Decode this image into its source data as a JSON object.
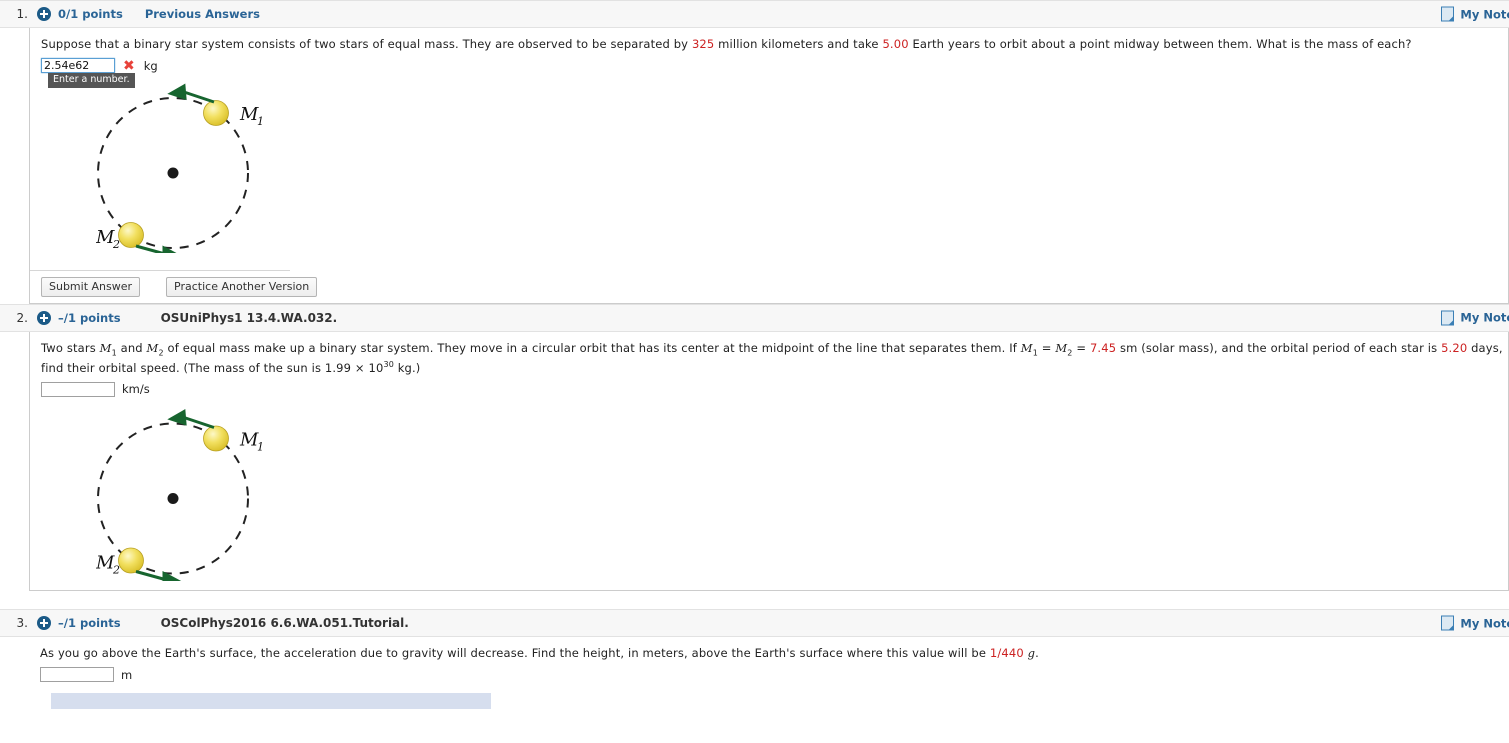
{
  "questions": [
    {
      "number": "1.",
      "points": "0/1 points",
      "previous_answers": "Previous Answers",
      "code": "",
      "notes_label": "My Notes",
      "notes_icon": "note-page-icon",
      "plus_icon": "plus-circle-icon",
      "prompt_parts": [
        {
          "t": "Suppose that a binary star system consists of two stars of equal mass. They are observed to be separated by ",
          "hl": false
        },
        {
          "t": "325",
          "hl": true
        },
        {
          "t": " million kilometers and take ",
          "hl": false
        },
        {
          "t": "5.00",
          "hl": true
        },
        {
          "t": " Earth years to orbit about a point midway between them. What is the mass of each?",
          "hl": false
        }
      ],
      "answer": {
        "value": "2.54e62",
        "placeholder": "",
        "unit": "kg",
        "status_icon": "x-mark-incorrect",
        "tooltip": "Enter a number.",
        "focused": true
      },
      "diagram": {
        "center_label": "center-of-mass-dot",
        "body1_label": "M",
        "body1_sub": "1",
        "body2_label": "M",
        "body2_sub": "2"
      },
      "buttons": [
        "Submit Answer",
        "Practice Another Version"
      ]
    },
    {
      "number": "2.",
      "points": "–/1 points",
      "previous_answers": "",
      "code": "OSUniPhys1 13.4.WA.032.",
      "notes_label": "My Notes",
      "notes_icon": "note-page-icon",
      "plus_icon": "plus-circle-icon",
      "prompt_html": "Two stars <span class=\"var\">M</span><sub>1</sub> and <span class=\"var\">M</span><sub>2</sub> of equal mass make up a binary star system. They move in a circular orbit that has its center at the midpoint of the line that separates them. If <span class=\"var\">M</span><sub>1</sub> = <span class=\"var\">M</span><sub>2</sub> = <span class=\"hl\">7.45</span> sm (solar mass), and the orbital period of each star is <span class=\"hl\">5.20</span> days, find their orbital speed. (The mass of the sun is 1.99 &#215; 10<sup>30</sup> kg.)",
      "answer": {
        "value": "",
        "placeholder": "",
        "unit": "km/s",
        "status_icon": "",
        "tooltip": "",
        "focused": false
      },
      "diagram": {
        "center_label": "center-of-mass-dot",
        "body1_label": "M",
        "body1_sub": "1",
        "body2_label": "M",
        "body2_sub": "2"
      },
      "buttons": []
    },
    {
      "number": "3.",
      "points": "–/1 points",
      "previous_answers": "",
      "code": "OSColPhys2016 6.6.WA.051.Tutorial.",
      "notes_label": "My Notes",
      "notes_icon": "note-page-icon",
      "plus_icon": "plus-circle-icon",
      "prompt_html": "As you go above the Earth's surface, the acceleration due to gravity will decrease. Find the height, in meters, above the Earth's surface where this value will be <span class=\"hl\">1/440</span> <span class=\"var\">g</span>.",
      "answer": {
        "value": "",
        "placeholder": "",
        "unit": "m",
        "status_icon": "",
        "tooltip": "",
        "focused": false
      },
      "diagram": null,
      "buttons": []
    }
  ],
  "colors": {
    "accent_link": "#2a6496",
    "header_bg": "#f7f7f7",
    "highlight_value": "#cc2222",
    "incorrect": "#e8423a",
    "plus_badge": "#1b5a87",
    "tutorial_panel": "#d6deee",
    "star_yellow": "#ecd94a",
    "arrow_green": "#17652f"
  }
}
